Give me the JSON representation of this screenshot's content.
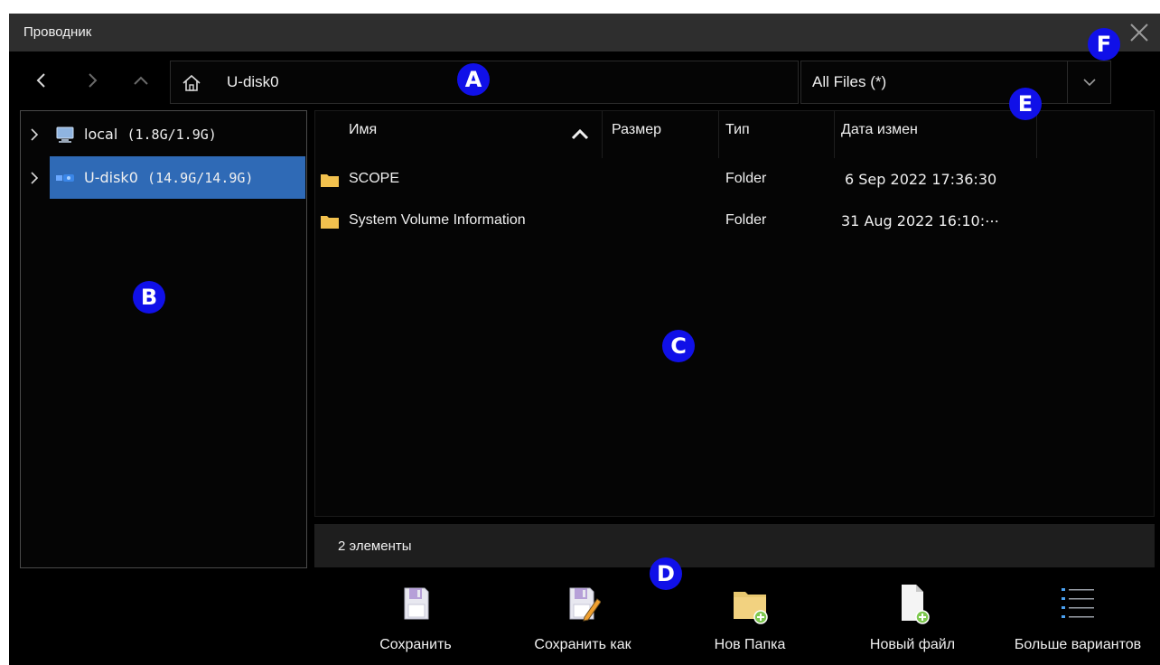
{
  "window": {
    "title": "Проводник"
  },
  "path": {
    "text": "U-disk0"
  },
  "filter": {
    "value": "All Files (*)"
  },
  "tree": {
    "items": [
      {
        "label": "local",
        "size": "(1.8G/1.9G)",
        "selected": false
      },
      {
        "label": "U-disk0",
        "size": "(14.9G/14.9G)",
        "selected": true
      }
    ]
  },
  "list": {
    "columns": {
      "name": "Имя",
      "size": "Размер",
      "type": "Тип",
      "date": "Дата измен"
    },
    "rows": [
      {
        "name": "SCOPE",
        "size": "",
        "type": "Folder",
        "date": "6 Sep 2022 17:36:30"
      },
      {
        "name": "System Volume Information",
        "size": "",
        "type": "Folder",
        "date": "31 Aug 2022 16:10:⋯"
      }
    ]
  },
  "status": {
    "text": "2 элементы"
  },
  "toolbar": {
    "save": "Сохранить",
    "save_as": "Сохранить как",
    "new_folder": "Нов Папка",
    "new_file": "Новый файл",
    "more": "Больше вариантов"
  },
  "callouts": {
    "a": "A",
    "b": "B",
    "c": "C",
    "d": "D",
    "e": "E",
    "f": "F"
  },
  "colors": {
    "selection": "#2f6ab6",
    "folder": "#f2c14e",
    "callout": "#1010e8",
    "titlebar": "#2e2e2e"
  }
}
